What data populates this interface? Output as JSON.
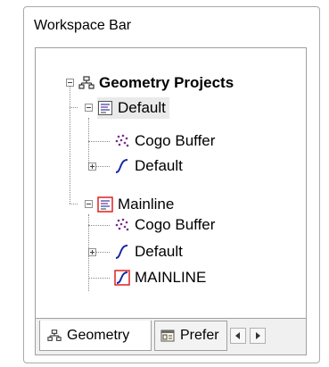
{
  "panel": {
    "title": "Workspace Bar"
  },
  "tree": {
    "root": {
      "label": "Geometry Projects",
      "expanded": true,
      "icon": "hierarchy-icon"
    },
    "projects": [
      {
        "label": "Default",
        "expanded": true,
        "icon": "project-icon",
        "selected": true,
        "children": [
          {
            "label": "Cogo Buffer",
            "icon": "points-icon"
          },
          {
            "label": "Default",
            "icon": "alignment-icon",
            "expandable": true
          }
        ]
      },
      {
        "label": "Mainline",
        "expanded": true,
        "icon": "project-active-icon",
        "children": [
          {
            "label": "Cogo Buffer",
            "icon": "points-icon"
          },
          {
            "label": "Default",
            "icon": "alignment-icon",
            "expandable": true
          },
          {
            "label": "MAINLINE",
            "icon": "alignment-active-icon"
          }
        ]
      }
    ]
  },
  "tabs": [
    {
      "label": "Geometry",
      "icon": "hierarchy-icon",
      "active": true
    },
    {
      "label": "Prefer",
      "icon": "preferences-icon",
      "active": false
    }
  ],
  "tab_scroll": {
    "left_icon": "triangle-left-icon",
    "right_icon": "triangle-right-icon"
  },
  "colors": {
    "accent_red": "#e02020",
    "points_purple": "#7a2a8a",
    "alignment_blue": "#1a2aa0"
  }
}
